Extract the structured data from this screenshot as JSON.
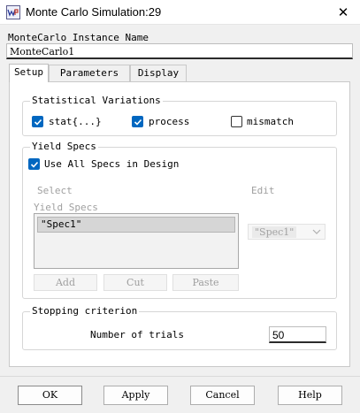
{
  "window": {
    "title": "Monte Carlo Simulation:29",
    "icon": "app-icon"
  },
  "instance": {
    "label": "MonteCarlo Instance Name",
    "value": "MonteCarlo1"
  },
  "tabs": [
    {
      "label": "Setup",
      "active": true
    },
    {
      "label": "Parameters",
      "active": false
    },
    {
      "label": "Display",
      "active": false
    }
  ],
  "statistical": {
    "title": "Statistical Variations",
    "options": [
      {
        "label": "stat{...}",
        "checked": true
      },
      {
        "label": "process",
        "checked": true
      },
      {
        "label": "mismatch",
        "checked": false
      }
    ]
  },
  "yield": {
    "title": "Yield Specs",
    "use_all_label": "Use All Specs in Design",
    "use_all_checked": true,
    "select_label": "Select",
    "edit_label": "Edit",
    "list_label": "Yield Specs",
    "items": [
      "\"Spec1\""
    ],
    "combo_value": "\"Spec1\"",
    "add_label": "Add",
    "cut_label": "Cut",
    "paste_label": "Paste"
  },
  "stopping": {
    "title": "Stopping criterion",
    "trials_label": "Number of trials",
    "trials_value": "50"
  },
  "footer": {
    "ok": "OK",
    "apply": "Apply",
    "cancel": "Cancel",
    "help": "Help"
  }
}
